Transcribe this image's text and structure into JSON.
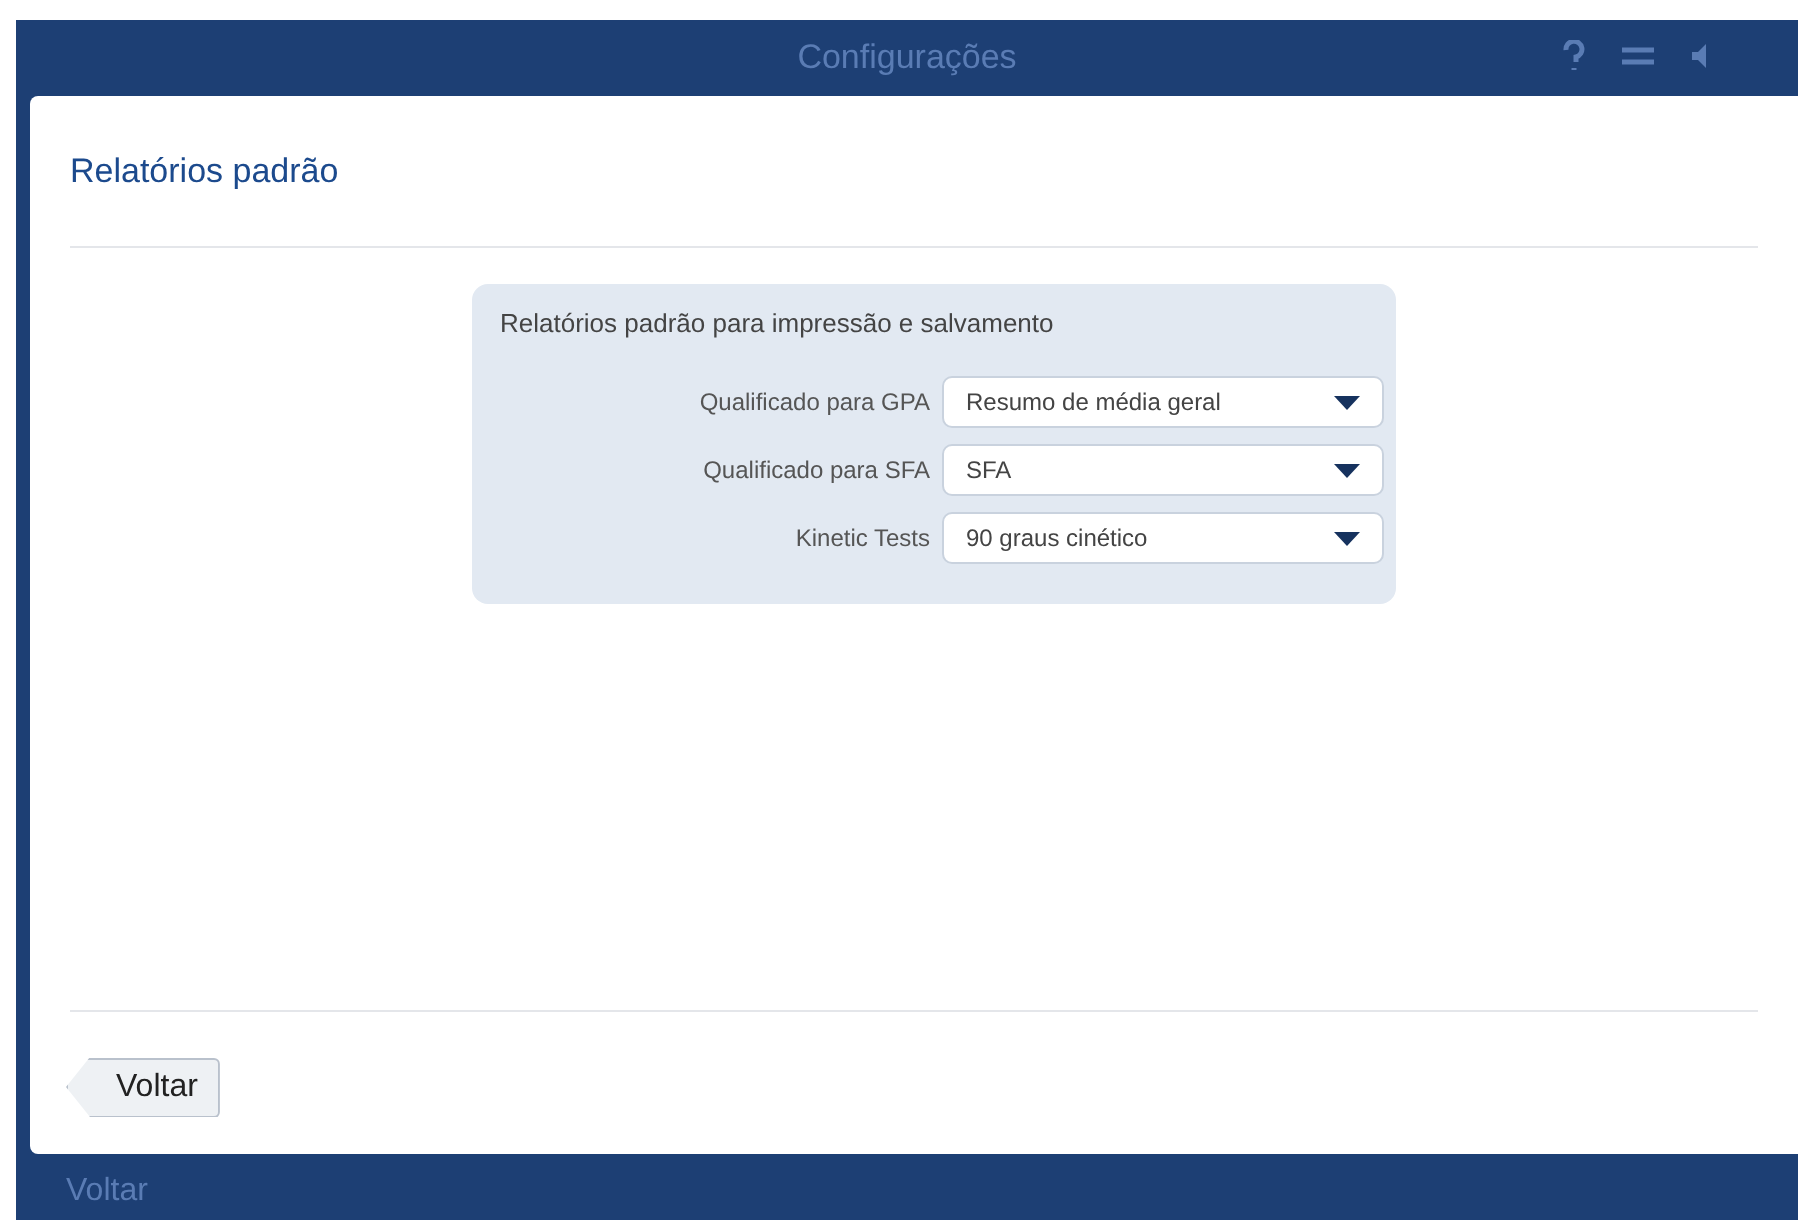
{
  "background": {
    "title": "Configurações",
    "back_label": "Voltar"
  },
  "dialog": {
    "title": "Relatórios padrão",
    "panel": {
      "heading": "Relatórios padrão para impressão e salvamento",
      "rows": [
        {
          "label": "Qualificado para GPA",
          "value": "Resumo de média geral"
        },
        {
          "label": "Qualificado para SFA",
          "value": "SFA"
        },
        {
          "label": "Kinetic Tests",
          "value": "90 graus cinético"
        }
      ]
    },
    "back_button": "Voltar"
  }
}
